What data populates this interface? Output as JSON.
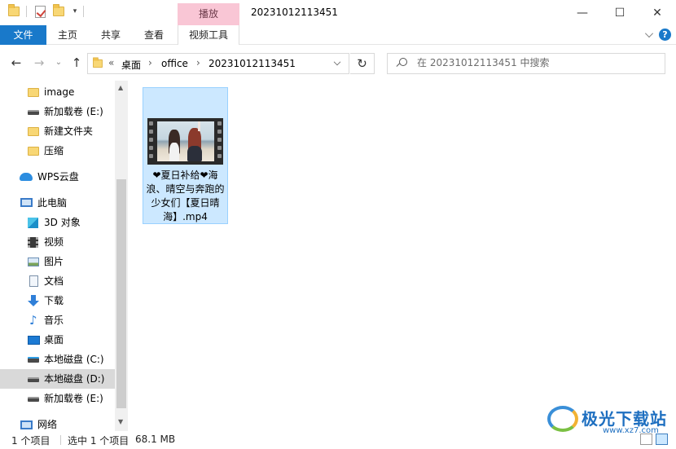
{
  "titlebar": {
    "contextual_tab": "播放",
    "title": "20231012113451",
    "minimize": "—",
    "maximize": "☐",
    "close": "✕"
  },
  "ribbon": {
    "tabs": [
      "文件",
      "主页",
      "共享",
      "查看",
      "视频工具"
    ],
    "help": "?"
  },
  "navbar": {
    "back": "←",
    "forward": "→",
    "recent": "⌄",
    "up": "↑",
    "overflow": "«",
    "breadcrumbs": [
      "桌面",
      "office",
      "20231012113451"
    ],
    "separator": "›",
    "refresh": "↻"
  },
  "search": {
    "placeholder": "在 20231012113451 中搜索"
  },
  "sidebar": {
    "items": [
      {
        "label": "image",
        "icon": "folder-icon"
      },
      {
        "label": "新加载卷 (E:)",
        "icon": "drive-icon"
      },
      {
        "label": "新建文件夹",
        "icon": "folder-icon"
      },
      {
        "label": "压缩",
        "icon": "folder-icon"
      },
      {
        "label": "WPS云盘",
        "icon": "cloud-icon"
      },
      {
        "label": "此电脑",
        "icon": "computer-icon"
      },
      {
        "label": "3D 对象",
        "icon": "cube-icon"
      },
      {
        "label": "视频",
        "icon": "video-icon"
      },
      {
        "label": "图片",
        "icon": "picture-icon"
      },
      {
        "label": "文档",
        "icon": "document-icon"
      },
      {
        "label": "下载",
        "icon": "download-icon"
      },
      {
        "label": "音乐",
        "icon": "music-icon"
      },
      {
        "label": "桌面",
        "icon": "desktop-icon"
      },
      {
        "label": "本地磁盘 (C:)",
        "icon": "system-drive-icon"
      },
      {
        "label": "本地磁盘 (D:)",
        "icon": "drive-icon",
        "selected": true
      },
      {
        "label": "新加载卷 (E:)",
        "icon": "drive-icon"
      },
      {
        "label": "网络",
        "icon": "network-icon"
      }
    ],
    "music_glyph": "♪"
  },
  "scrollbar": {
    "up": "▲",
    "down": "▼"
  },
  "content": {
    "file": {
      "name": "❤夏日补给❤海浪、晴空与奔跑的少女们【夏日晴海】.mp4",
      "type": "video"
    }
  },
  "status": {
    "count": "1 个项目",
    "selected": "选中 1 个项目",
    "size": "68.1 MB"
  },
  "watermark": {
    "text": "极光下载站",
    "url": "www.xz7.com"
  },
  "colors": {
    "file_tab": "#1979ca",
    "contextual_tab": "#f9c6d5",
    "selection": "#cce8ff"
  }
}
